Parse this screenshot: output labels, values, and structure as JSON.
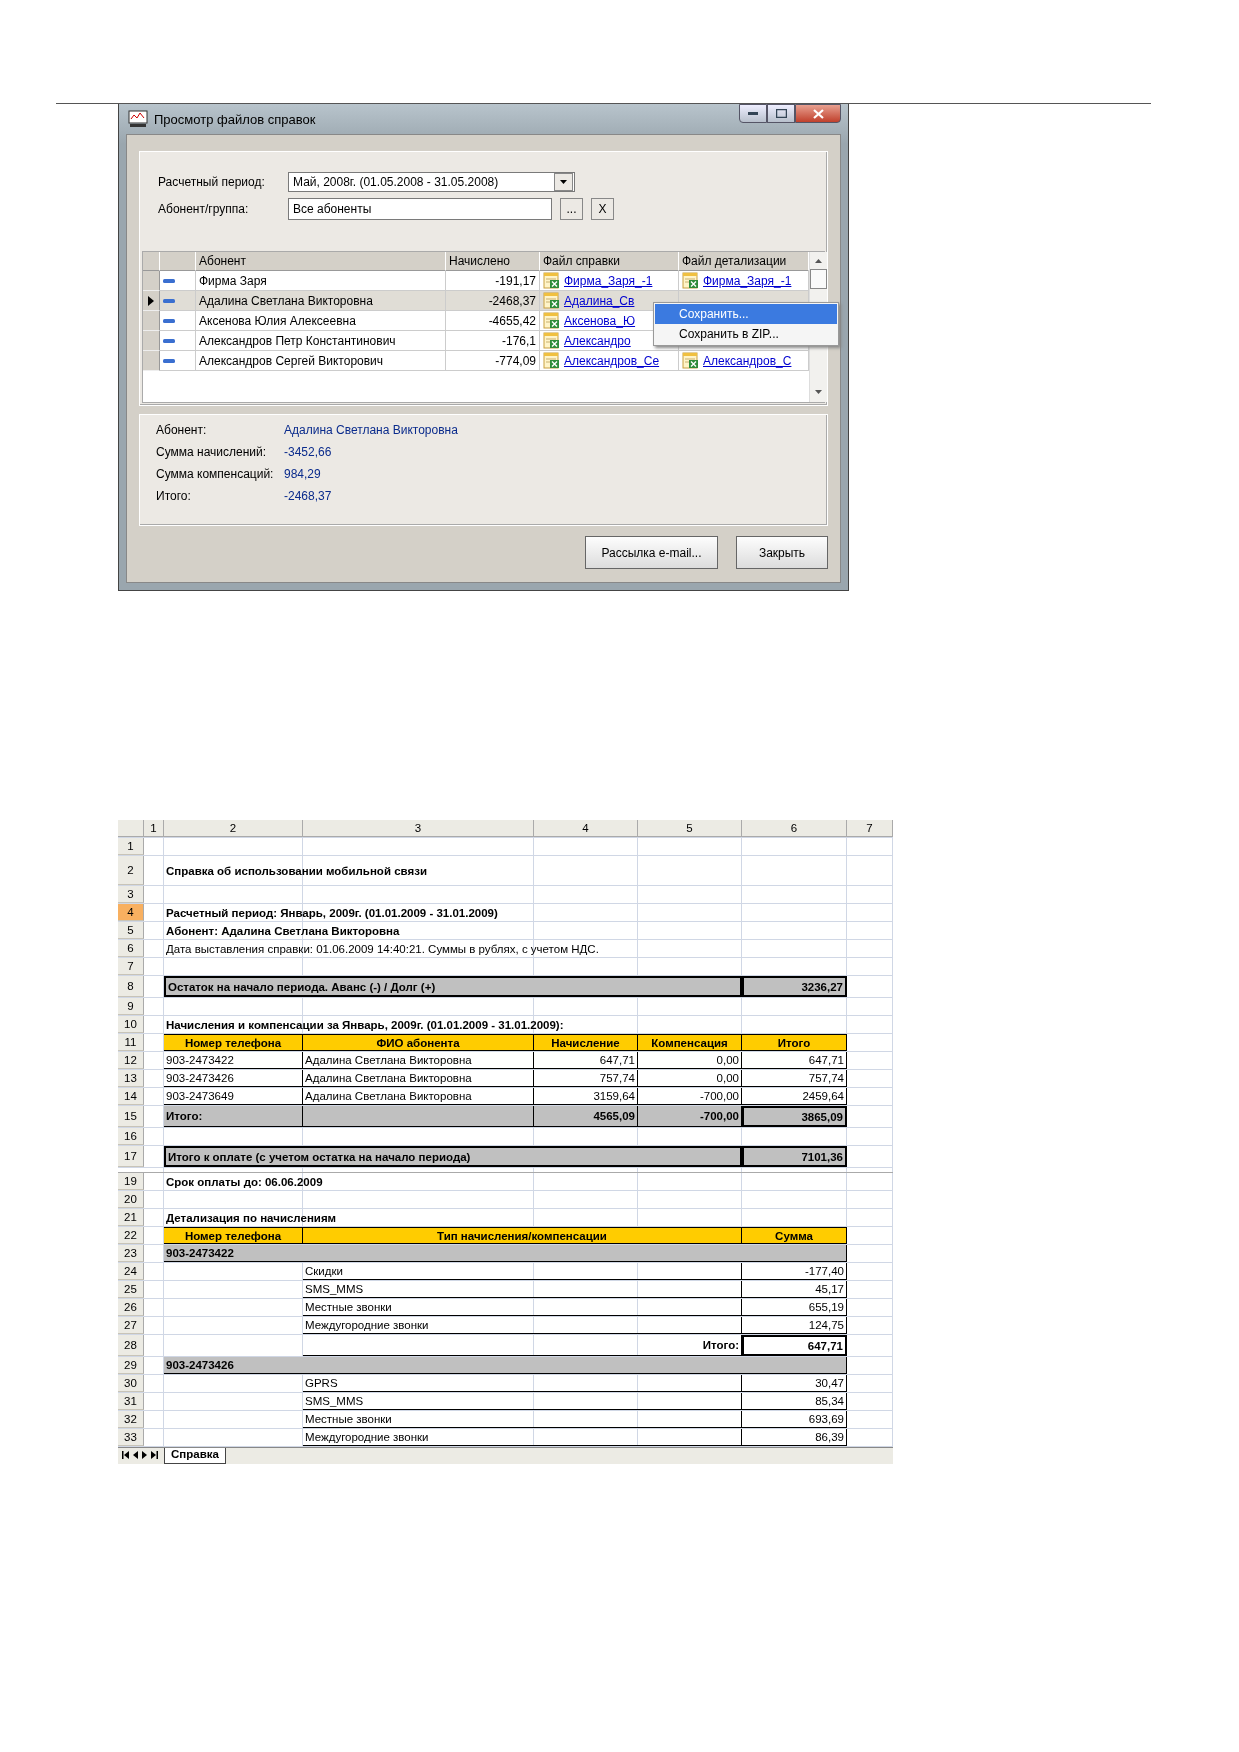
{
  "window": {
    "title": "Просмотр файлов справок",
    "filters": [
      {
        "kind": "combo",
        "label": "Расчетный период:",
        "value": "Май, 2008г. (01.05.2008 - 31.05.2008)"
      },
      {
        "kind": "picker",
        "label": "Абонент/группа:",
        "value": "Все абоненты",
        "buttons": [
          "...",
          "X"
        ]
      }
    ],
    "grid": {
      "columns": [
        "Абонент",
        "Начислено",
        "Файл справки",
        "Файл детализации"
      ],
      "rows": [
        {
          "name": "Фирма Заря",
          "amount": "-191,17",
          "report_file": "Фирма_Заря_-1",
          "detail_file": "Фирма_Заря_-1",
          "selected": false
        },
        {
          "name": "Адалина Светлана Викторовна",
          "amount": "-2468,37",
          "report_file": "Адалина_Св",
          "selected": true
        },
        {
          "name": "Аксенова Юлия Алексеевна",
          "amount": "-4655,42",
          "report_file": "Аксенова_Ю",
          "selected": false
        },
        {
          "name": "Александров Петр Константинович",
          "amount": "-176,1",
          "report_file": "Александро",
          "selected": false
        },
        {
          "name": "Александров Сергей Викторович",
          "amount": "-774,09",
          "report_file": "Александров_Се",
          "detail_file": "Александров_С",
          "selected": false
        }
      ]
    },
    "context_menu": [
      {
        "label": "Сохранить...",
        "selected": true
      },
      {
        "label": "Сохранить в ZIP...",
        "selected": false
      }
    ],
    "info": [
      {
        "label": "Абонент:",
        "value": "Адалина Светлана Викторовна"
      },
      {
        "label": "Сумма начислений:",
        "value": "-3452,66"
      },
      {
        "label": "Сумма компенсаций:",
        "value": "984,29"
      },
      {
        "label": "Итого:",
        "value": "-2468,37"
      }
    ],
    "buttons": [
      "Рассылка e-mail...",
      "Закрыть"
    ]
  },
  "sheet": {
    "columns": [
      "1",
      "2",
      "3",
      "4",
      "5",
      "6",
      "7"
    ],
    "rows": [
      {
        "n": "1",
        "kind": "blank",
        "selected": false
      },
      {
        "n": "2",
        "kind": "title",
        "selected": false,
        "cells": [
          "Справка об использовании мобильной связи"
        ]
      },
      {
        "n": "3",
        "kind": "blank",
        "selected": false
      },
      {
        "n": "4",
        "kind": "bold-text",
        "selected": true,
        "cells": [
          "Расчетный период: Январь, 2009г. (01.01.2009 - 31.01.2009)"
        ]
      },
      {
        "n": "5",
        "kind": "bold-text",
        "selected": false,
        "cells": [
          "Абонент: Адалина Светлана Викторовна"
        ]
      },
      {
        "n": "6",
        "kind": "text",
        "selected": false,
        "cells": [
          "Дата выставления справки: 01.06.2009 14:40:21. Суммы в рублях, с учетом НДС."
        ]
      },
      {
        "n": "7",
        "kind": "blank",
        "selected": false
      },
      {
        "n": "8",
        "kind": "balance",
        "selected": false,
        "cells": [
          "Остаток на начало периода.  Аванс (-) / Долг (+)",
          "3236,27"
        ]
      },
      {
        "n": "9",
        "kind": "blank",
        "selected": false
      },
      {
        "n": "10",
        "kind": "heading",
        "selected": false,
        "cells": [
          "Начисления и компенсации за Январь, 2009г. (01.01.2009 - 31.01.2009):"
        ]
      },
      {
        "n": "11",
        "kind": "table-head",
        "selected": false,
        "cells": [
          "Номер телефона",
          "ФИО абонента",
          "Начисление",
          "Компенсация",
          "Итого"
        ]
      },
      {
        "n": "12",
        "kind": "table-row",
        "selected": false,
        "cells": [
          "903-2473422",
          "Адалина Светлана Викторовна",
          "647,71",
          "0,00",
          "647,71"
        ]
      },
      {
        "n": "13",
        "kind": "table-row",
        "selected": false,
        "cells": [
          "903-2473426",
          "Адалина Светлана Викторовна",
          "757,74",
          "0,00",
          "757,74"
        ]
      },
      {
        "n": "14",
        "kind": "table-row",
        "selected": false,
        "cells": [
          "903-2473649",
          "Адалина Светлана Викторовна",
          "3159,64",
          "-700,00",
          "2459,64"
        ]
      },
      {
        "n": "15",
        "kind": "table-total",
        "selected": false,
        "cells": [
          "Итого:",
          "4565,09",
          "-700,00",
          "3865,09"
        ]
      },
      {
        "n": "16",
        "kind": "blank",
        "selected": false
      },
      {
        "n": "17",
        "kind": "balance",
        "selected": false,
        "cells": [
          "Итого к оплате (с учетом остатка на начало периода)",
          "7101,36"
        ]
      },
      {
        "n": "19",
        "kind": "due",
        "selected": false,
        "cells": [
          "Срок оплаты до: 06.06.2009"
        ]
      },
      {
        "n": "20",
        "kind": "blank",
        "selected": false
      },
      {
        "n": "21",
        "kind": "heading",
        "selected": false,
        "cells": [
          "Детализация по начислениям"
        ]
      },
      {
        "n": "22",
        "kind": "detail-head",
        "selected": false,
        "cells": [
          "Номер телефона",
          "Тип начисления/компенсации",
          "Сумма"
        ]
      },
      {
        "n": "23",
        "kind": "group",
        "selected": false,
        "cells": [
          "903-2473422"
        ]
      },
      {
        "n": "24",
        "kind": "detail",
        "selected": false,
        "cells": [
          "Скидки",
          "-177,40"
        ]
      },
      {
        "n": "25",
        "kind": "detail",
        "selected": false,
        "cells": [
          "SMS_MMS",
          "45,17"
        ]
      },
      {
        "n": "26",
        "kind": "detail",
        "selected": false,
        "cells": [
          "Местные звонки",
          "655,19"
        ]
      },
      {
        "n": "27",
        "kind": "detail",
        "selected": false,
        "cells": [
          "Междугородние звонки",
          "124,75"
        ]
      },
      {
        "n": "28",
        "kind": "subtotal",
        "selected": false,
        "cells": [
          "Итого:",
          "647,71"
        ]
      },
      {
        "n": "29",
        "kind": "group",
        "selected": false,
        "cells": [
          "903-2473426"
        ]
      },
      {
        "n": "30",
        "kind": "detail",
        "selected": false,
        "cells": [
          "GPRS",
          "30,47"
        ]
      },
      {
        "n": "31",
        "kind": "detail",
        "selected": false,
        "cells": [
          "SMS_MMS",
          "85,34"
        ]
      },
      {
        "n": "32",
        "kind": "detail",
        "selected": false,
        "cells": [
          "Местные звонки",
          "693,69"
        ]
      },
      {
        "n": "33",
        "kind": "detail",
        "selected": false,
        "cells": [
          "Междугородние звонки",
          "86,39"
        ]
      }
    ],
    "tabs": [
      {
        "label": "Справка",
        "selected": true
      }
    ]
  }
}
